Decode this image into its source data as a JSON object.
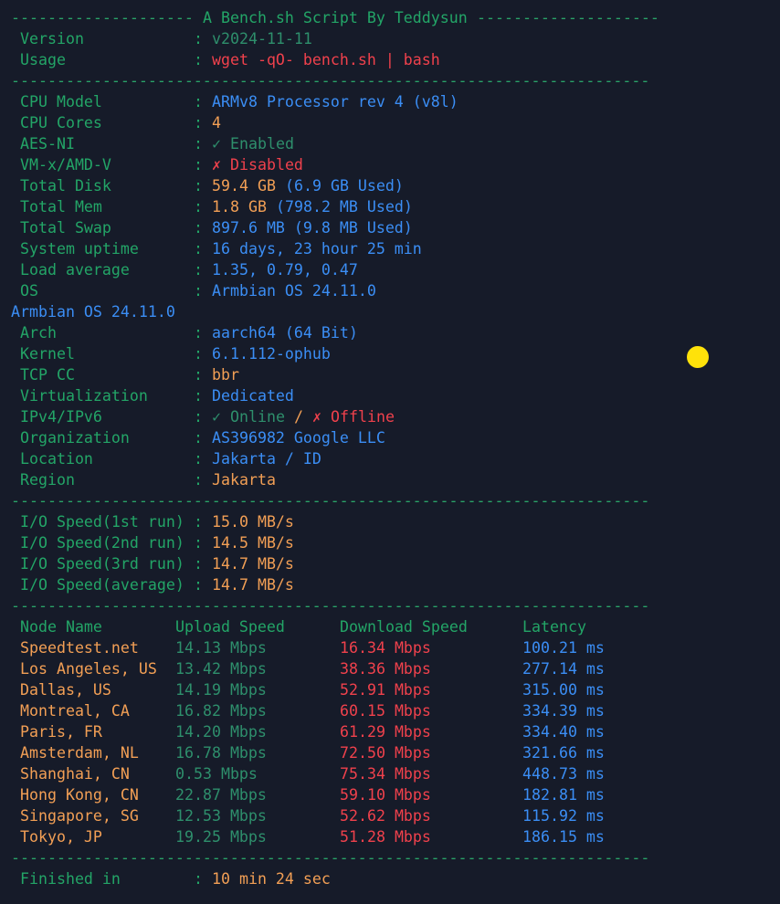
{
  "colors": {
    "background": "#161b29",
    "green": "#23a567",
    "teal": "#2e8f6c",
    "red": "#f0414c",
    "blue": "#3b8ef5",
    "orange": "#f29f55"
  },
  "header": {
    "left_dashes": "--------------------",
    "title": "A Bench.sh Script By Teddysun",
    "right_dashes": "--------------------"
  },
  "divider": "----------------------------------------------------------------------",
  "colon": ":",
  "info": {
    "version_label": "Version",
    "version_value": "v2024-11-11",
    "usage_label": "Usage",
    "usage_value": "wget -qO- bench.sh | bash"
  },
  "system": {
    "cpu_model_label": "CPU Model",
    "cpu_model_value": "ARMv8 Processor rev 4 (v8l)",
    "cpu_cores_label": "CPU Cores",
    "cpu_cores_value": "4",
    "aes_label": "AES-NI",
    "aes_icon": "✓",
    "aes_value": "Enabled",
    "vmx_label": "VM-x/AMD-V",
    "vmx_icon": "✗",
    "vmx_value": "Disabled",
    "disk_label": "Total Disk",
    "disk_value": "59.4 GB",
    "disk_used": "(6.9 GB Used)",
    "mem_label": "Total Mem",
    "mem_value": "1.8 GB",
    "mem_used": "(798.2 MB Used)",
    "swap_label": "Total Swap",
    "swap_value": "897.6 MB (9.8 MB Used)",
    "uptime_label": "System uptime",
    "uptime_value": "16 days, 23 hour 25 min",
    "load_label": "Load average",
    "load_value": "1.35, 0.79, 0.47",
    "os_label": "OS",
    "os_value": "Armbian OS 24.11.0",
    "os_wrap": "Armbian OS 24.11.0",
    "arch_label": "Arch",
    "arch_value": "aarch64 (64 Bit)",
    "kernel_label": "Kernel",
    "kernel_value": "6.1.112-ophub",
    "tcp_label": "TCP CC",
    "tcp_value": "bbr",
    "virt_label": "Virtualization",
    "virt_value": "Dedicated",
    "ip_label": "IPv4/IPv6",
    "ipv4_icon": "✓",
    "ipv4_value": "Online",
    "ip_sep": "/",
    "ipv6_icon": "✗",
    "ipv6_value": "Offline",
    "org_label": "Organization",
    "org_value": "AS396982 Google LLC",
    "loc_label": "Location",
    "loc_value": "Jakarta / ID",
    "region_label": "Region",
    "region_value": "Jakarta"
  },
  "io": {
    "run1_label": "I/O Speed(1st run)",
    "run1_value": "15.0 MB/s",
    "run2_label": "I/O Speed(2nd run)",
    "run2_value": "14.5 MB/s",
    "run3_label": "I/O Speed(3rd run)",
    "run3_value": "14.7 MB/s",
    "avg_label": "I/O Speed(average)",
    "avg_value": "14.7 MB/s"
  },
  "speed": {
    "headers": {
      "node": "Node Name",
      "upload": "Upload Speed",
      "download": "Download Speed",
      "latency": "Latency"
    },
    "rows": [
      {
        "node": "Speedtest.net",
        "upload": "14.13 Mbps",
        "download": "16.34 Mbps",
        "latency": "100.21 ms"
      },
      {
        "node": "Los Angeles, US",
        "upload": "13.42 Mbps",
        "download": "38.36 Mbps",
        "latency": "277.14 ms"
      },
      {
        "node": "Dallas, US",
        "upload": "14.19 Mbps",
        "download": "52.91 Mbps",
        "latency": "315.00 ms"
      },
      {
        "node": "Montreal, CA",
        "upload": "16.82 Mbps",
        "download": "60.15 Mbps",
        "latency": "334.39 ms"
      },
      {
        "node": "Paris, FR",
        "upload": "14.20 Mbps",
        "download": "61.29 Mbps",
        "latency": "334.40 ms"
      },
      {
        "node": "Amsterdam, NL",
        "upload": "16.78 Mbps",
        "download": "72.50 Mbps",
        "latency": "321.66 ms"
      },
      {
        "node": "Shanghai, CN",
        "upload": "0.53 Mbps",
        "download": "75.34 Mbps",
        "latency": "448.73 ms"
      },
      {
        "node": "Hong Kong, CN",
        "upload": "22.87 Mbps",
        "download": "59.10 Mbps",
        "latency": "182.81 ms"
      },
      {
        "node": "Singapore, SG",
        "upload": "12.53 Mbps",
        "download": "52.62 Mbps",
        "latency": "115.92 ms"
      },
      {
        "node": "Tokyo, JP",
        "upload": "19.25 Mbps",
        "download": "51.28 Mbps",
        "latency": "186.15 ms"
      }
    ]
  },
  "footer": {
    "finished_label": "Finished in",
    "finished_value": "10 min 24 sec"
  }
}
